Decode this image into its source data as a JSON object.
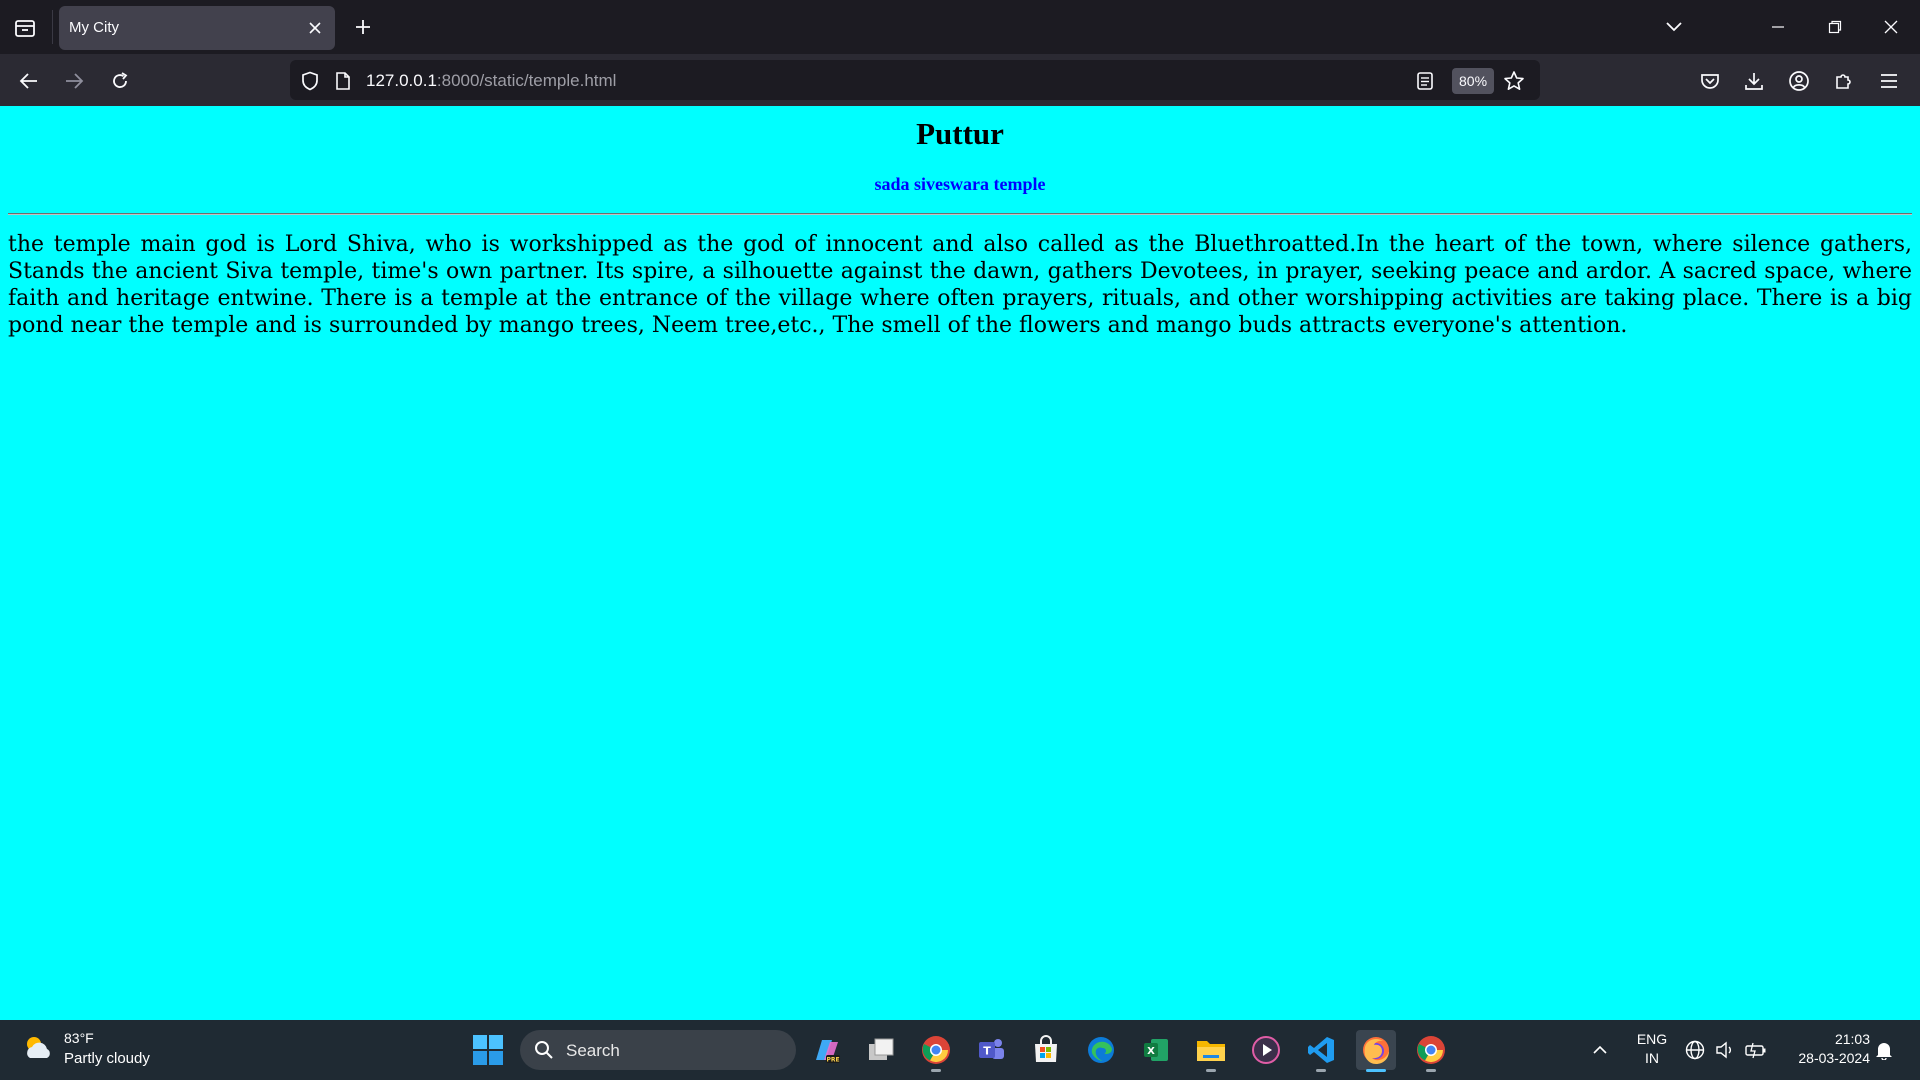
{
  "browser": {
    "tab": {
      "title": "My City"
    },
    "url": {
      "host": "127.0.0.1",
      "rest": ":8000/static/temple.html"
    },
    "zoom": "80%"
  },
  "page": {
    "title": "Puttur",
    "subtitle": "sada siveswara temple",
    "paragraph": "the temple main god is Lord Shiva, who is workshipped as the god of innocent and also called as the Bluethroatted.In the heart of the town, where silence gathers, Stands the ancient Siva temple, time's own partner. Its spire, a silhouette against the dawn, gathers Devotees, in prayer, seeking peace and ardor. A sacred space, where faith and heritage entwine. There is a temple at the entrance of the village where often prayers, rituals, and other worshipping activities are taking place. There is a big pond near the temple and is surrounded by mango trees, Neem tree,etc., The smell of the flowers and mango buds attracts everyone's attention.",
    "background_color": "#00ffff",
    "subtitle_color": "#0000ff"
  },
  "taskbar": {
    "weather": {
      "temp": "83°F",
      "desc": "Partly cloudy",
      "icon": "partly-cloudy-icon"
    },
    "search_label": "Search",
    "apps": [
      "copilot",
      "task-view",
      "chrome",
      "teams",
      "microsoft-store",
      "edge",
      "excel",
      "file-explorer",
      "media-player",
      "vscode",
      "firefox",
      "chrome-profile"
    ],
    "lang_line1": "ENG",
    "lang_line2": "IN",
    "time": "21:03",
    "date": "28-03-2024"
  }
}
